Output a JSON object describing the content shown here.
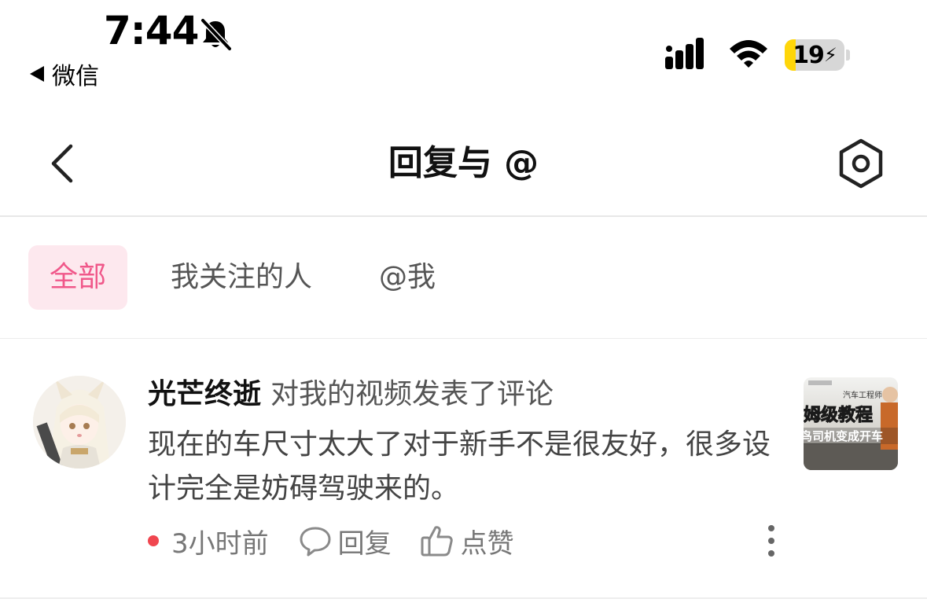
{
  "status_bar": {
    "time": "7:44",
    "back_app": "微信",
    "battery": "19",
    "battery_level_percent": 19,
    "icons": [
      "bell-slash-icon",
      "signal-icon",
      "wifi-icon",
      "battery-charging-icon"
    ]
  },
  "nav": {
    "title": "回复与 @",
    "icons": [
      "chevron-left-icon",
      "hexagon-settings-icon"
    ]
  },
  "tabs": [
    {
      "label": "全部",
      "active": true
    },
    {
      "label": "我关注的人",
      "active": false
    },
    {
      "label": "@我",
      "active": false
    }
  ],
  "notifications": [
    {
      "user": "光芒终逝",
      "action": "对我的视频发表了评论",
      "comment": "现在的车尺寸太大了对于新手不是很友好，很多设计完全是妨碍驾驶来的。",
      "time": "3小时前",
      "reply_label": "回复",
      "like_label": "点赞",
      "thumbnail": {
        "small_caption": "汽车工程师",
        "headline": "姆级教程",
        "subtitle": "鸟司机变成开车"
      }
    }
  ],
  "colors": {
    "accent": "#f0588a",
    "tab_active_bg": "#fde8ee",
    "unread_dot": "#f0464f",
    "battery_fill": "#ffd60a"
  }
}
